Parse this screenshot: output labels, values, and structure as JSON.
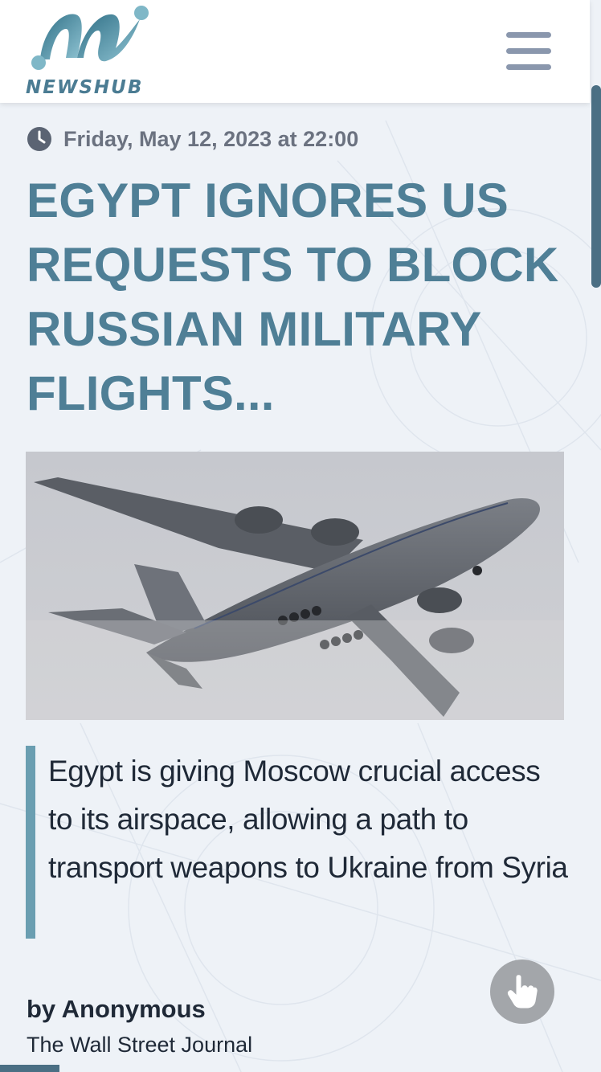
{
  "header": {
    "logo_text": "NEWSHUB",
    "logo_icon": "newshub-logo-icon",
    "menu_icon": "hamburger-menu-icon"
  },
  "article": {
    "date": "Friday, May 12, 2023 at 22:00",
    "date_icon": "clock-icon",
    "headline": "EGYPT IGNORES US REQUESTS TO BLOCK RUSSIAN MILITARY FLIGHTS...",
    "image": "military-cargo-plane-photo",
    "lede": "Egypt is giving Moscow crucial access to its airspace, allowing a path to transport weapons to Ukraine from Syria",
    "byline": "by Anonymous",
    "source": "The Wall Street Journal"
  },
  "fab": {
    "icon": "hand-pointer-icon"
  },
  "colors": {
    "accent": "#4f7f96",
    "quote_border": "#6a9eb1",
    "background": "#eef2f7",
    "header_bg": "#ffffff",
    "menu_icon": "#8a97ad",
    "fab_bg": "#a3a6aa"
  }
}
